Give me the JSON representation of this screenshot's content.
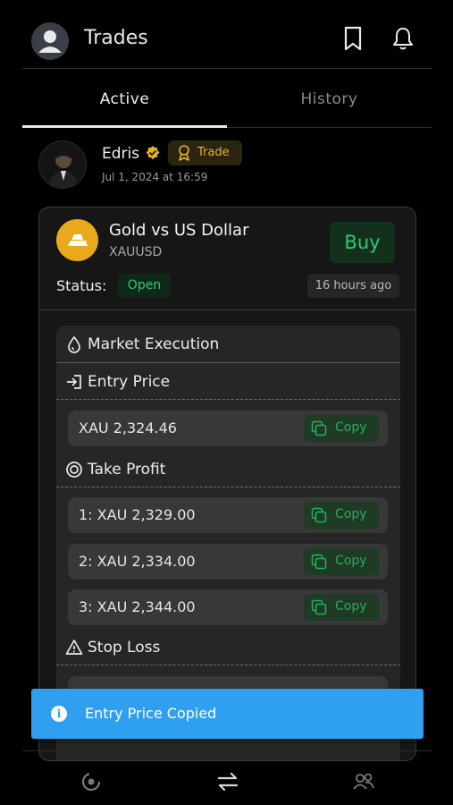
{
  "header": {
    "title": "Trades",
    "avatar_icon": "user-avatar-icon",
    "bookmark_icon": "bookmark-icon",
    "bell_icon": "bell-icon"
  },
  "tabs": [
    {
      "label": "Active",
      "active": true
    },
    {
      "label": "History",
      "active": false
    }
  ],
  "post": {
    "author_name": "Edris",
    "badge_label": "Trade",
    "date": "Jul 1, 2024 at 16:59"
  },
  "instrument": {
    "name": "Gold vs US Dollar",
    "symbol": "XAUUSD",
    "action": "Buy",
    "status_label": "Status:",
    "status_value": "Open",
    "time_ago": "16 hours ago"
  },
  "execution": {
    "type_label": "Market Execution",
    "entry_label": "Entry Price",
    "entry_value": "XAU 2,324.46",
    "take_profit_label": "Take Profit",
    "take_profits": [
      {
        "label": "1: XAU 2,329.00"
      },
      {
        "label": "2: XAU 2,334.00"
      },
      {
        "label": "3: XAU 2,344.00"
      }
    ],
    "stop_loss_label": "Stop Loss",
    "copy_label": "Copy"
  },
  "toast": {
    "message": "Entry Price Copied"
  },
  "colors": {
    "accent_green": "#2ecc71",
    "toast_blue": "#2f9fef",
    "gold": "#e9a91b",
    "badge_gold": "#e6b422"
  },
  "bottom_nav": [
    {
      "icon": "signals-icon"
    },
    {
      "icon": "swap-arrows-icon"
    },
    {
      "icon": "community-icon"
    }
  ]
}
